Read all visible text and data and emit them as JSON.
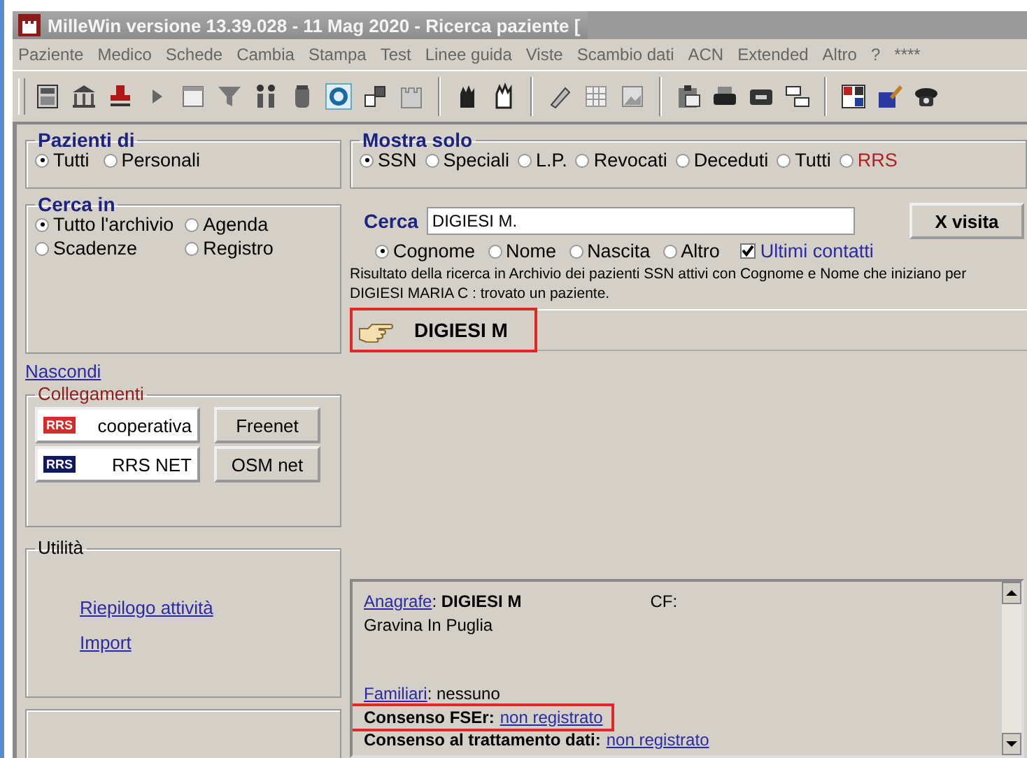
{
  "window": {
    "title": "MilleWin versione 13.39.028 - 11 Mag 2020 - Ricerca paziente ["
  },
  "menu": [
    "Paziente",
    "Medico",
    "Schede",
    "Cambia",
    "Stampa",
    "Test",
    "Linee guida",
    "Viste",
    "Scambio dati",
    "ACN",
    "Extended",
    "Altro",
    "?",
    "****"
  ],
  "pazienti_di": {
    "title": "Pazienti di",
    "options": [
      {
        "label": "Tutti",
        "selected": true
      },
      {
        "label": "Personali",
        "selected": false
      }
    ]
  },
  "cerca_in": {
    "title": "Cerca in",
    "options": [
      {
        "label": "Tutto l'archivio",
        "selected": true
      },
      {
        "label": "Agenda",
        "selected": false
      },
      {
        "label": "Scadenze",
        "selected": false
      },
      {
        "label": "Registro",
        "selected": false
      }
    ]
  },
  "nascondi_link": "Nascondi",
  "collegamenti": {
    "title": "Collegamenti",
    "buttons": [
      {
        "badge": "RRS",
        "color": "#d42a2a",
        "label": "cooperativa"
      },
      {
        "label": "Freenet"
      },
      {
        "badge": "RRS",
        "color": "#101860",
        "label": "RRS NET"
      },
      {
        "label": "OSM net"
      }
    ]
  },
  "utilita": {
    "title": "Utilità",
    "links": [
      "Riepilogo attività",
      "Import"
    ]
  },
  "mostra_solo": {
    "title": "Mostra solo",
    "options": [
      {
        "label": "SSN",
        "selected": true,
        "color": "#000000"
      },
      {
        "label": "Speciali",
        "selected": false,
        "color": "#000000"
      },
      {
        "label": "L.P.",
        "selected": false,
        "color": "#000000"
      },
      {
        "label": "Revocati",
        "selected": false,
        "color": "#000000"
      },
      {
        "label": "Deceduti",
        "selected": false,
        "color": "#000000"
      },
      {
        "label": "Tutti",
        "selected": false,
        "color": "#000000"
      },
      {
        "label": "RRS",
        "selected": false,
        "color": "#b02020"
      }
    ]
  },
  "search": {
    "label": "Cerca",
    "value": "DIGIESI M.",
    "button": "X visita",
    "fields": [
      {
        "label": "Cognome",
        "selected": true
      },
      {
        "label": "Nome",
        "selected": false
      },
      {
        "label": "Nascita",
        "selected": false
      },
      {
        "label": "Altro",
        "selected": false
      }
    ],
    "ultimi_contatti": {
      "label": "Ultimi contatti",
      "checked": true
    }
  },
  "result_text": "Risultato della ricerca in Archivio dei pazienti SSN attivi  con Cognome e Nome che iniziano per DIGIESI MARIA C : trovato un paziente.",
  "patients": [
    {
      "name": "DIGIESI M",
      "highlighted": true
    }
  ],
  "details": [
    {
      "lines": [
        {
          "highlighted": false,
          "segments": [
            {
              "kind": "link",
              "text": "Anagrafe"
            },
            {
              "kind": "plain",
              "text": ": **DIGIESI M**"
            },
            {
              "kind": "aside",
              "text": "CF:"
            }
          ]
        },
        {
          "highlighted": false,
          "segments": [
            {
              "kind": "plain",
              "text": "Gravina In Puglia"
            }
          ]
        }
      ]
    },
    {
      "lines": [
        {
          "highlighted": false,
          "segments": [
            {
              "kind": "link",
              "text": "Familiari"
            },
            {
              "kind": "plain",
              "text": ": nessuno"
            }
          ]
        },
        {
          "highlighted": true,
          "segments": [
            {
              "kind": "bold",
              "text": "Consenso FSEr:"
            },
            {
              "kind": "link",
              "text": "non registrato"
            }
          ]
        },
        {
          "highlighted": false,
          "segments": [
            {
              "kind": "bold",
              "text": "Consenso al trattamento dati:"
            },
            {
              "kind": "link",
              "text": "non registrato"
            }
          ]
        }
      ]
    }
  ]
}
